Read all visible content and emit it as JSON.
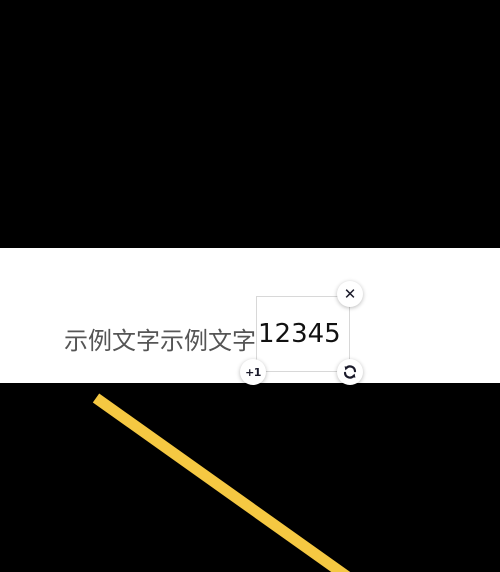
{
  "colors": {
    "background": "#000000",
    "band": "#ffffff",
    "line": "#f5c842",
    "static_text": "#555555",
    "sticker_text": "#111111",
    "handle_icon": "#1a1a2a"
  },
  "content": {
    "static_text": "示例文字示例文字",
    "sticker_text": "12345"
  },
  "handles": {
    "close_icon": "close-icon",
    "close_glyph": "✕",
    "duplicate_label": "+1",
    "rotate_icon": "rotate-icon"
  }
}
